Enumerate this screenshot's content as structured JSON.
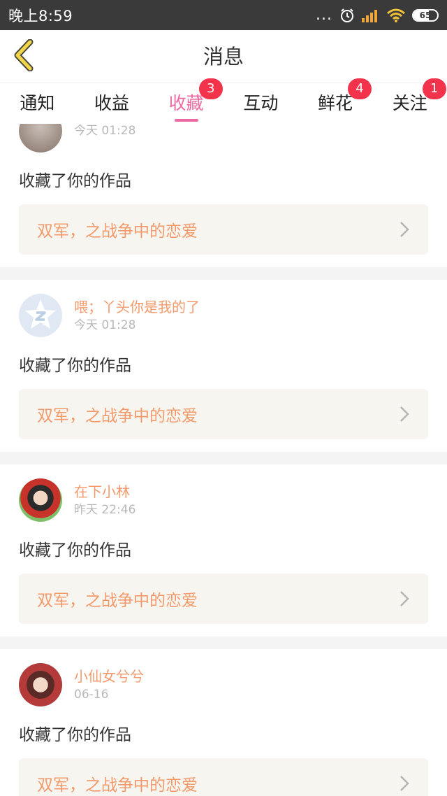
{
  "status_bar": {
    "time": "晚上8:59",
    "dots": "...",
    "battery": "65",
    "battery_level": 0.65,
    "icons": [
      "alarm-icon",
      "signal-icon",
      "wifi-icon",
      "battery-icon"
    ]
  },
  "header": {
    "title": "消息",
    "back_icon": "chevron-left-icon"
  },
  "tabs": [
    {
      "label": "通知",
      "badge": ""
    },
    {
      "label": "收益",
      "badge": ""
    },
    {
      "label": "收藏",
      "badge": "3",
      "active": true
    },
    {
      "label": "互动",
      "badge": ""
    },
    {
      "label": "鲜花",
      "badge": "4"
    },
    {
      "label": "关注",
      "badge": "1"
    }
  ],
  "feed": [
    {
      "username": "",
      "time": "今天 01:28",
      "action": "收藏了你的作品",
      "work": "双军，之战争中的恋爱",
      "avatar": "photo"
    },
    {
      "username": "喂；丫头你是我的了",
      "time": "今天 01:28",
      "action": "收藏了你的作品",
      "work": "双军，之战争中的恋爱",
      "avatar": "qq-default"
    },
    {
      "username": "在下小林",
      "time": "昨天 22:46",
      "action": "收藏了你的作品",
      "work": "双军，之战争中的恋爱",
      "avatar": "anime-girl-red"
    },
    {
      "username": "小仙女兮兮",
      "time": "06-16",
      "action": "收藏了你的作品",
      "work": "双军，之战争中的恋爱",
      "avatar": "anime-girl-flowers"
    }
  ],
  "colors": {
    "accent": "#ea6aa1",
    "badge": "#f3324c",
    "username": "#f39a6c",
    "work_bg": "#f6f5ef",
    "statusbar_bg": "#3a3a3a"
  }
}
